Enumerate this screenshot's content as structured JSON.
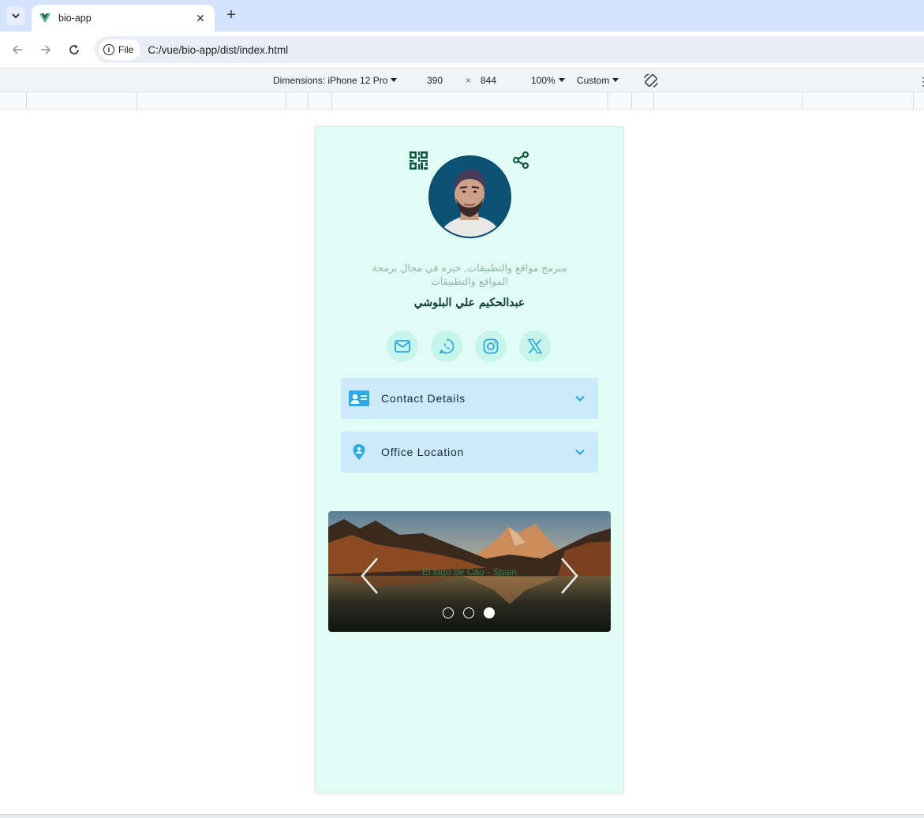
{
  "browser": {
    "tab_title": "bio-app",
    "tab_close": "✕",
    "new_tab": "+",
    "url_chip": "File",
    "url": "C:/vue/bio-app/dist/index.html"
  },
  "devtools": {
    "dimensions_label": "Dimensions: iPhone 12 Pro",
    "width": "390",
    "times": "×",
    "height": "844",
    "zoom": "100%",
    "throttle": "Custom"
  },
  "profile": {
    "bio": "مبرمج مواقع والتطبيقات, خبره في مجال برمجة المواقع والتطبيقات",
    "name": "عبدالحكيم علي البلوشي"
  },
  "socials": [
    {
      "name": "mail-icon"
    },
    {
      "name": "whatsapp-icon"
    },
    {
      "name": "instagram-icon"
    },
    {
      "name": "x-icon"
    }
  ],
  "accordions": [
    {
      "label": "Contact Details",
      "icon": "contact-card-icon"
    },
    {
      "label": "Office Location",
      "icon": "location-pin-icon"
    }
  ],
  "carousel": {
    "caption": "El lago de Cao - Spain",
    "slide_count": 3,
    "active_index": 2
  },
  "colors": {
    "page_bg": "#e0fcf4",
    "accent": "#0f5a3e",
    "accordion_bg": "#cdeafb",
    "icon_blue": "#29a9e6"
  }
}
